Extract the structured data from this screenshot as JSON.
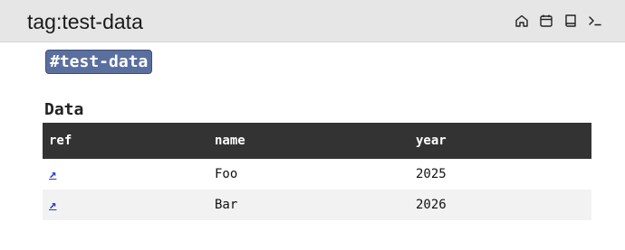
{
  "header": {
    "title": "tag:test-data",
    "actions": [
      {
        "icon": "home-icon"
      },
      {
        "icon": "calendar-icon"
      },
      {
        "icon": "book-icon"
      },
      {
        "icon": "terminal-icon"
      }
    ]
  },
  "tag": {
    "label": "#test-data",
    "color": "#5b6f9e"
  },
  "section": {
    "heading": "Data"
  },
  "table": {
    "columns": [
      "ref",
      "name",
      "year"
    ],
    "rows": [
      {
        "ref": "↗",
        "name": "Foo",
        "year": "2025"
      },
      {
        "ref": "↗",
        "name": "Bar",
        "year": "2026"
      }
    ],
    "header_color": "#333333",
    "link_color": "#2a3ccf"
  }
}
